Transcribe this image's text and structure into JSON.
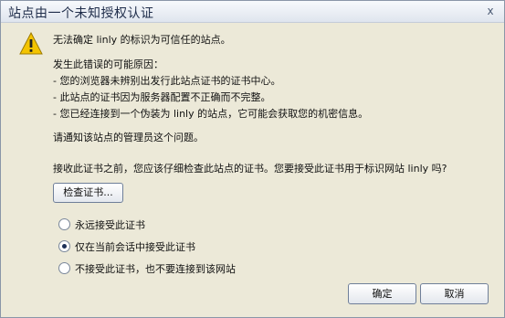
{
  "window": {
    "title": "站点由一个未知授权认证",
    "close_label": "x"
  },
  "icons": {
    "warning": "warning-icon",
    "close": "close-icon"
  },
  "message": {
    "line1": "无法确定 linly 的标识为可信任的站点。",
    "reasons_title": "发生此错误的可能原因：",
    "reason1": "- 您的浏览器未辨别出发行此站点证书的证书中心。",
    "reason2": "- 此站点的证书因为服务器配置不正确而不完整。",
    "reason3": "- 您已经连接到一个伪装为 linly 的站点，它可能会获取您的机密信息。",
    "notify": "请通知该站点的管理员这个问题。",
    "question": "接收此证书之前，您应该仔细检查此站点的证书。您要接受此证书用于标识网站 linly 吗?"
  },
  "actions": {
    "examine_label": "检查证书..."
  },
  "options": {
    "opt1": "永远接受此证书",
    "opt2": "仅在当前会话中接受此证书",
    "opt3": "不接受此证书，也不要连接到该网站",
    "selected": "opt2"
  },
  "footer": {
    "ok_label": "确定",
    "cancel_label": "取消"
  }
}
